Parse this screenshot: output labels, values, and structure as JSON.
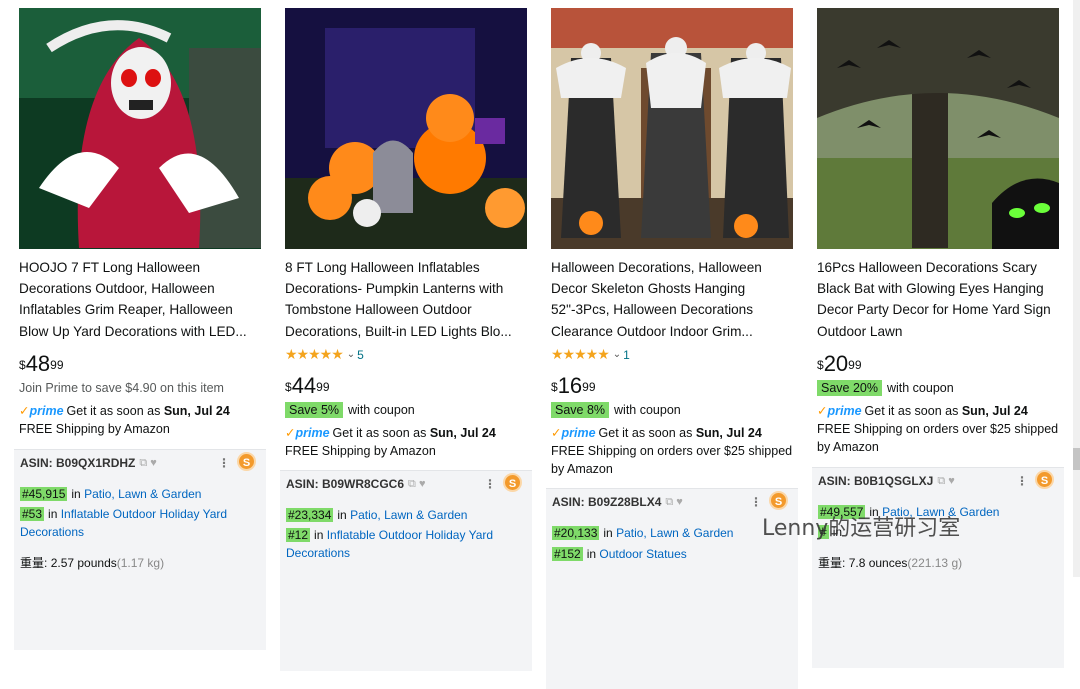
{
  "products": [
    {
      "title": "HOOJO 7 FT Long Halloween Decorations Outdoor, Halloween Inflatables Grim Reaper, Halloween Blow Up Yard Decorations with LED...",
      "price": {
        "symbol": "$",
        "whole": "48",
        "cents": "99"
      },
      "join_prime": "Join Prime to save $4.90 on this item",
      "prime_text": "Get it as soon as",
      "delivery_date": "Sun, Jul 24",
      "shipping": "FREE Shipping by Amazon",
      "asin": "ASIN: B09QX1RDHZ",
      "ranks": [
        {
          "num": "#45,915",
          "in": "in",
          "cat": "Patio, Lawn & Garden"
        },
        {
          "num": "#53",
          "in": "in",
          "cat": "Inflatable Outdoor Holiday Yard Decorations"
        }
      ],
      "weight_label": "重量:",
      "weight": "2.57 pounds",
      "weight_g": "(1.17 kg)"
    },
    {
      "title": "8 FT Long Halloween Inflatables Decorations- Pumpkin Lanterns with Tombstone Halloween Outdoor Decorations, Built-in LED Lights Blo...",
      "rating_stars": "★★★★★",
      "rating_count": "5",
      "price": {
        "symbol": "$",
        "whole": "44",
        "cents": "99"
      },
      "coupon": "Save 5%",
      "coupon_text": "with coupon",
      "prime_text": "Get it as soon as",
      "delivery_date": "Sun, Jul 24",
      "shipping": "FREE Shipping by Amazon",
      "asin": "ASIN: B09WR8CGC6",
      "ranks": [
        {
          "num": "#23,334",
          "in": "in",
          "cat": "Patio, Lawn & Garden"
        },
        {
          "num": "#12",
          "in": "in",
          "cat": "Inflatable Outdoor Holiday Yard Decorations"
        }
      ]
    },
    {
      "title": "Halloween Decorations, Halloween Decor Skeleton Ghosts Hanging 52\"-3Pcs, Halloween Decorations Clearance Outdoor Indoor Grim...",
      "rating_stars": "★★★★★",
      "rating_count": "1",
      "price": {
        "symbol": "$",
        "whole": "16",
        "cents": "99"
      },
      "coupon": "Save 8%",
      "coupon_text": "with coupon",
      "prime_text": "Get it as soon as",
      "delivery_date": "Sun, Jul 24",
      "shipping": "FREE Shipping on orders over $25 shipped by Amazon",
      "asin": "ASIN: B09Z28BLX4",
      "ranks": [
        {
          "num": "#20,133",
          "in": "in",
          "cat": "Patio, Lawn & Garden"
        },
        {
          "num": "#152",
          "in": "in",
          "cat": "Outdoor Statues"
        }
      ]
    },
    {
      "title": "16Pcs Halloween Decorations Scary Black Bat with Glowing Eyes Hanging Decor Party Decor for Home Yard Sign Outdoor Lawn",
      "price": {
        "symbol": "$",
        "whole": "20",
        "cents": "99"
      },
      "coupon": "Save 20%",
      "coupon_text": "with coupon",
      "prime_text": "Get it as soon as",
      "delivery_date": "Sun, Jul 24",
      "shipping": "FREE Shipping on orders over $25 shipped by Amazon",
      "asin": "ASIN: B0B1QSGLXJ",
      "ranks": [
        {
          "num": "#49,557",
          "in": "in",
          "cat": "Patio, Lawn & Garden"
        },
        {
          "num": "#",
          "in": "in",
          "cat": ""
        }
      ],
      "weight_label": "重量:",
      "weight": "7.8 ounces",
      "weight_g": "(221.13 g)"
    }
  ],
  "prime_label": "prime",
  "watermark": "Lenny的运营研习室",
  "colors": {
    "badge": "#7fda69",
    "link": "#0066c0",
    "prime": "#1a98ff",
    "stars": "#f4a41d"
  }
}
